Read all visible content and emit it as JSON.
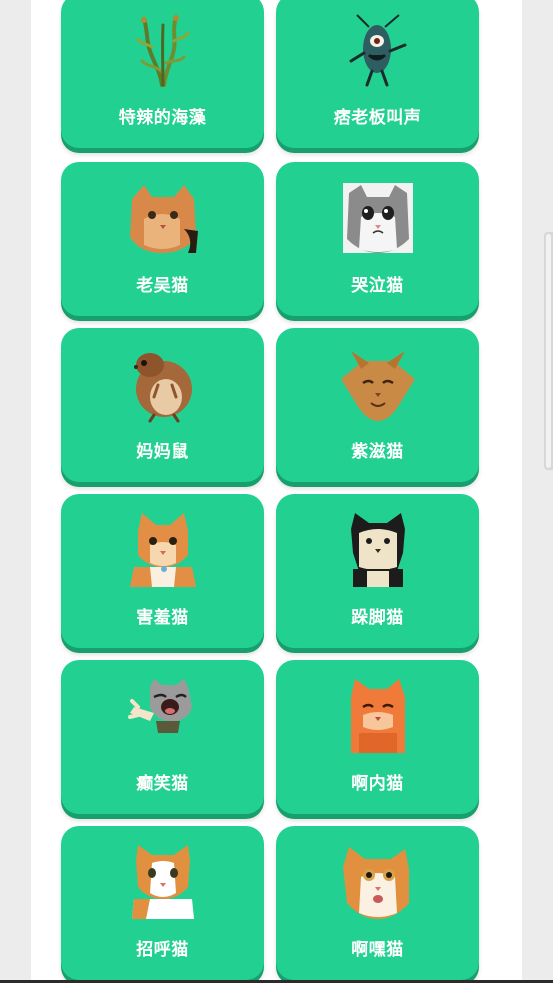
{
  "cards": [
    {
      "label": "特辣的海藻",
      "icon": "seaweed-icon"
    },
    {
      "label": "痞老板叫声",
      "icon": "plankton-icon"
    },
    {
      "label": "老吴猫",
      "icon": "cat-icon"
    },
    {
      "label": "哭泣猫",
      "icon": "crying-cat-icon"
    },
    {
      "label": "妈妈鼠",
      "icon": "hamster-icon"
    },
    {
      "label": "紫滋猫",
      "icon": "cat-icon"
    },
    {
      "label": "害羞猫",
      "icon": "cat-icon"
    },
    {
      "label": "跺脚猫",
      "icon": "black-white-cat-icon"
    },
    {
      "label": "癫笑猫",
      "icon": "laughing-cat-icon"
    },
    {
      "label": "啊内猫",
      "icon": "cat-icon"
    },
    {
      "label": "招呼猫",
      "icon": "cat-icon"
    },
    {
      "label": "啊嘿猫",
      "icon": "cat-icon"
    }
  ],
  "colors": {
    "card": "#22d192",
    "card_shadow": "#17a06e",
    "page": "#ffffff",
    "backdrop": "#ececec"
  }
}
